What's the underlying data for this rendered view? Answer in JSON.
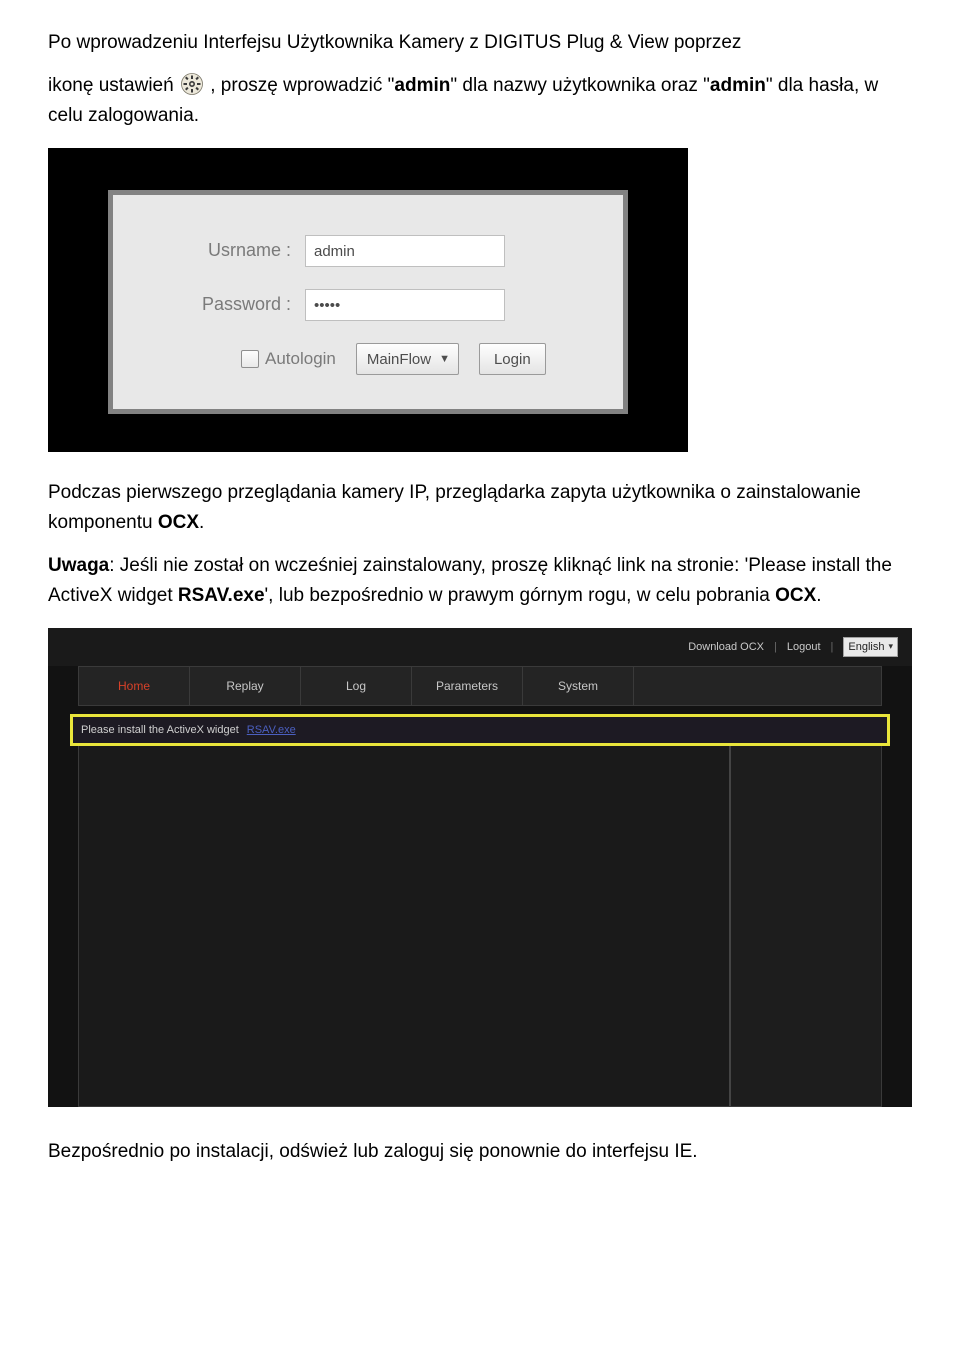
{
  "doc": {
    "p1_a": "Po wprowadzeniu Interfejsu Użytkownika Kamery z DIGITUS Plug & View poprzez",
    "p1_b1": "ikonę ustawień ",
    "p1_b2": ", proszę wprowadzić \"",
    "p1_b3": "admin",
    "p1_b4": "\" dla nazwy użytkownika oraz \"",
    "p1_b5": "admin",
    "p1_b6": "\" dla hasła, w celu zalogowania.",
    "p2_a": "Podczas pierwszego przeglądania kamery IP, przeglądarka zapyta użytkownika o zainstalowanie komponentu ",
    "p2_b": "OCX",
    "p2_c": ".",
    "p3_a": "Uwaga",
    "p3_b": ": Jeśli nie został on wcześniej zainstalowany, proszę kliknąć link na stronie: 'Please install the ActiveX widget ",
    "p3_c": "RSAV.exe",
    "p3_d": "', lub bezpośrednio w prawym górnym rogu, w celu pobrania ",
    "p3_e": "OCX",
    "p3_f": ".",
    "p4": "Bezpośrednio po instalacji, odśwież lub zaloguj się ponownie do interfejsu IE."
  },
  "login": {
    "usr_label": "Usrname  :",
    "pwd_label": "Password  :",
    "usr_value": "admin",
    "pwd_value": "•••••",
    "autologin": "Autologin",
    "stream": "MainFlow",
    "login_btn": "Login"
  },
  "cam": {
    "download_ocx": "Download OCX",
    "logout": "Logout",
    "lang": "English",
    "tabs": {
      "home": "Home",
      "replay": "Replay",
      "log": "Log",
      "parameters": "Parameters",
      "system": "System"
    },
    "ocx_msg": "Please install the ActiveX widget",
    "ocx_link": "RSAV.exe"
  }
}
